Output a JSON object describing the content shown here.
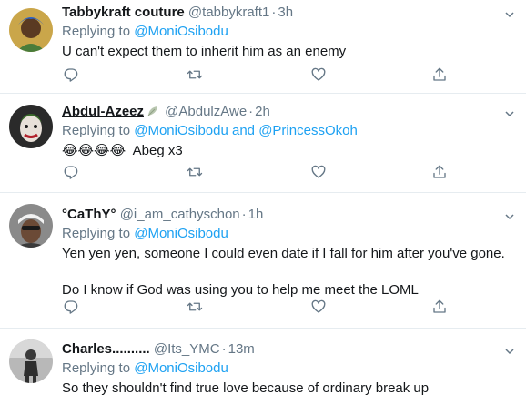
{
  "tweets": [
    {
      "name": "Tabbykraft couture",
      "handle": "@tabbykraft1",
      "time": "3h",
      "replying_prefix": "Replying to ",
      "replying_to": "@MoniOsibodu",
      "replying_conj": "",
      "replying_to2": "",
      "body": [
        "U can't expect them to inherit him as an enemy"
      ]
    },
    {
      "name": "Abdul-Azeez",
      "handle": "@AbdulzAwe",
      "time": "2h",
      "replying_prefix": "Replying to ",
      "replying_to": "@MoniOsibodu",
      "replying_conj": " and ",
      "replying_to2": "@PrincessOkoh_",
      "emoji": "😂😂😂😂",
      "body": [
        "Abeg x3"
      ]
    },
    {
      "name": "°CaThY°",
      "handle": "@i_am_cathyschon",
      "time": "1h",
      "replying_prefix": "Replying to ",
      "replying_to": "@MoniOsibodu",
      "replying_conj": "",
      "replying_to2": "",
      "body": [
        "Yen yen yen, someone I could even date if I fall for him after you've gone.",
        "Do I know if God was using you to help me meet the LOML"
      ]
    },
    {
      "name": "Charles..........",
      "handle": "@Its_YMC",
      "time": "13m",
      "replying_prefix": "Replying to ",
      "replying_to": "@MoniOsibodu",
      "replying_conj": "",
      "replying_to2": "",
      "body": [
        "So they shouldn't find true love because of ordinary break up"
      ]
    }
  ],
  "dot": "·",
  "icons": {
    "reply": "reply-icon",
    "retweet": "retweet-icon",
    "like": "like-icon",
    "share": "share-icon",
    "more": "chevron-down-icon",
    "leaf": "leaf-icon"
  },
  "colors": {
    "link": "#1da1f2",
    "muted": "#657786",
    "border": "#e6ecf0",
    "text": "#14171a"
  }
}
